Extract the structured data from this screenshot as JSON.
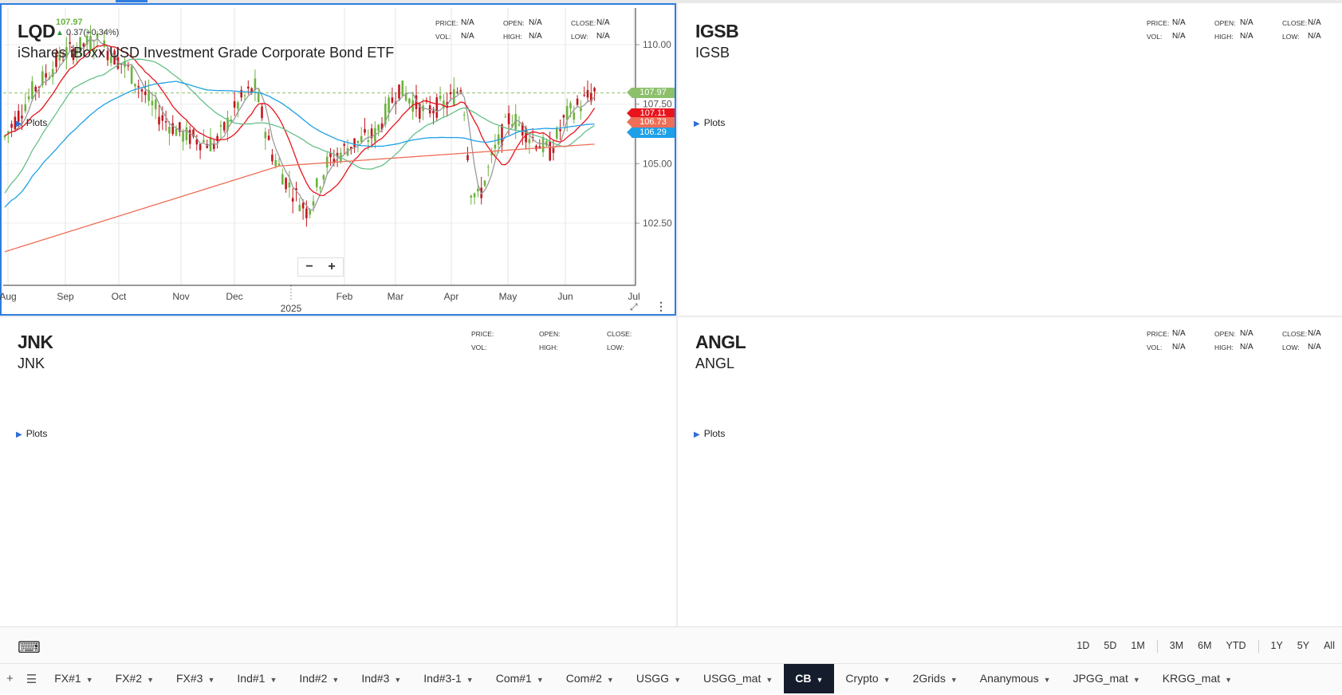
{
  "panels": {
    "lqd": {
      "symbol": "LQD",
      "name": "iShares iBoxx USD Investment Grade Corporate Bond ETF",
      "last_price": "107.97",
      "change": "0.37(+0.34%)",
      "stats": {
        "price": "N/A",
        "vol": "N/A",
        "open": "N/A",
        "high": "N/A",
        "close": "N/A",
        "low": "N/A"
      },
      "plots_label": "Plots",
      "y_ticks": [
        "110.00",
        "107.50",
        "105.00",
        "102.50"
      ],
      "x_ticks": [
        "Aug",
        "Sep",
        "Oct",
        "Nov",
        "Dec",
        "Feb",
        "Mar",
        "Apr",
        "May",
        "Jun",
        "Jul"
      ],
      "year_label": "2025",
      "price_tags": [
        {
          "value": "107.97",
          "color": "#8cc06a"
        },
        {
          "value": "107.11",
          "color": "#e8141c"
        },
        {
          "value": "106.73",
          "color": "#ee6e58"
        },
        {
          "value": "106.29",
          "color": "#1ea0e6"
        }
      ],
      "zoom_out": "−",
      "zoom_in": "+"
    },
    "igsb": {
      "symbol": "IGSB",
      "name": "IGSB",
      "plots_label": "Plots",
      "stats": {
        "price": "N/A",
        "vol": "N/A",
        "open": "N/A",
        "high": "N/A",
        "close": "N/A",
        "low": "N/A"
      }
    },
    "jnk": {
      "symbol": "JNK",
      "name": "JNK",
      "plots_label": "Plots",
      "stats": {
        "price": "",
        "vol": "",
        "open": "",
        "high": "",
        "close": "",
        "low": ""
      }
    },
    "angl": {
      "symbol": "ANGL",
      "name": "ANGL",
      "plots_label": "Plots",
      "stats": {
        "price": "N/A",
        "vol": "N/A",
        "open": "N/A",
        "high": "N/A",
        "close": "N/A",
        "low": "N/A"
      }
    }
  },
  "stat_labels": {
    "price": "PRICE:",
    "vol": "VOL:",
    "open": "OPEN:",
    "high": "HIGH:",
    "close": "CLOSE:",
    "low": "LOW:"
  },
  "ranges": [
    "1D",
    "5D",
    "1M",
    "3M",
    "6M",
    "YTD",
    "1Y",
    "5Y",
    "All"
  ],
  "tabs": [
    "FX#1",
    "FX#2",
    "FX#3",
    "Ind#1",
    "Ind#2",
    "Ind#3",
    "Ind#3-1",
    "Com#1",
    "Com#2",
    "USGG",
    "USGG_mat",
    "CB",
    "Crypto",
    "2Grids",
    "Ananymous",
    "JPGG_mat",
    "KRGG_mat"
  ],
  "active_tab": "CB",
  "colors": {
    "accent": "#2f7de1",
    "up": "#6db33f",
    "down": "#c0181e",
    "ma_gray": "#999999",
    "ma_red": "#e8141c",
    "ma_green": "#66c08a",
    "ma_blue": "#1ea0e6",
    "ma_salmon": "#ee6e58"
  }
}
